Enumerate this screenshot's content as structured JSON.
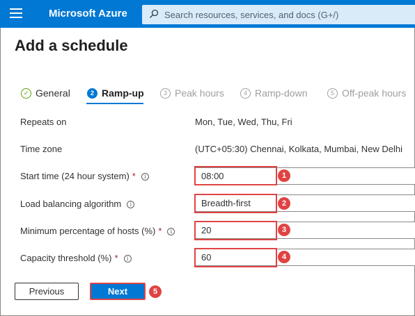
{
  "header": {
    "brand": "Microsoft Azure",
    "search_placeholder": "Search resources, services, and docs (G+/)"
  },
  "page": {
    "title": "Add a schedule"
  },
  "tabs": [
    {
      "num": "✓",
      "label": "General",
      "state": "completed"
    },
    {
      "num": "2",
      "label": "Ramp-up",
      "state": "active"
    },
    {
      "num": "3",
      "label": "Peak hours",
      "state": "disabled"
    },
    {
      "num": "4",
      "label": "Ramp-down",
      "state": "disabled"
    },
    {
      "num": "5",
      "label": "Off-peak hours",
      "state": "disabled"
    }
  ],
  "form": {
    "repeats_on": {
      "label": "Repeats on",
      "value": "Mon, Tue, Wed, Thu, Fri"
    },
    "time_zone": {
      "label": "Time zone",
      "value": "(UTC+05:30) Chennai, Kolkata, Mumbai, New Delhi"
    },
    "start_time": {
      "label": "Start time (24 hour system)",
      "required": "*",
      "value": "08:00",
      "marker": "1"
    },
    "lb_algorithm": {
      "label": "Load balancing algorithm",
      "value": "Breadth-first",
      "marker": "2"
    },
    "min_hosts": {
      "label": "Minimum percentage of hosts (%)",
      "required": "*",
      "value": "20",
      "marker": "3"
    },
    "capacity": {
      "label": "Capacity threshold (%)",
      "required": "*",
      "value": "60",
      "marker": "4"
    }
  },
  "info_glyph": "i",
  "buttons": {
    "previous": "Previous",
    "next": "Next",
    "next_marker": "5"
  },
  "colors": {
    "brand": "#0078d4",
    "highlight": "#e04343",
    "required": "#a4262c",
    "completed": "#57a300"
  }
}
